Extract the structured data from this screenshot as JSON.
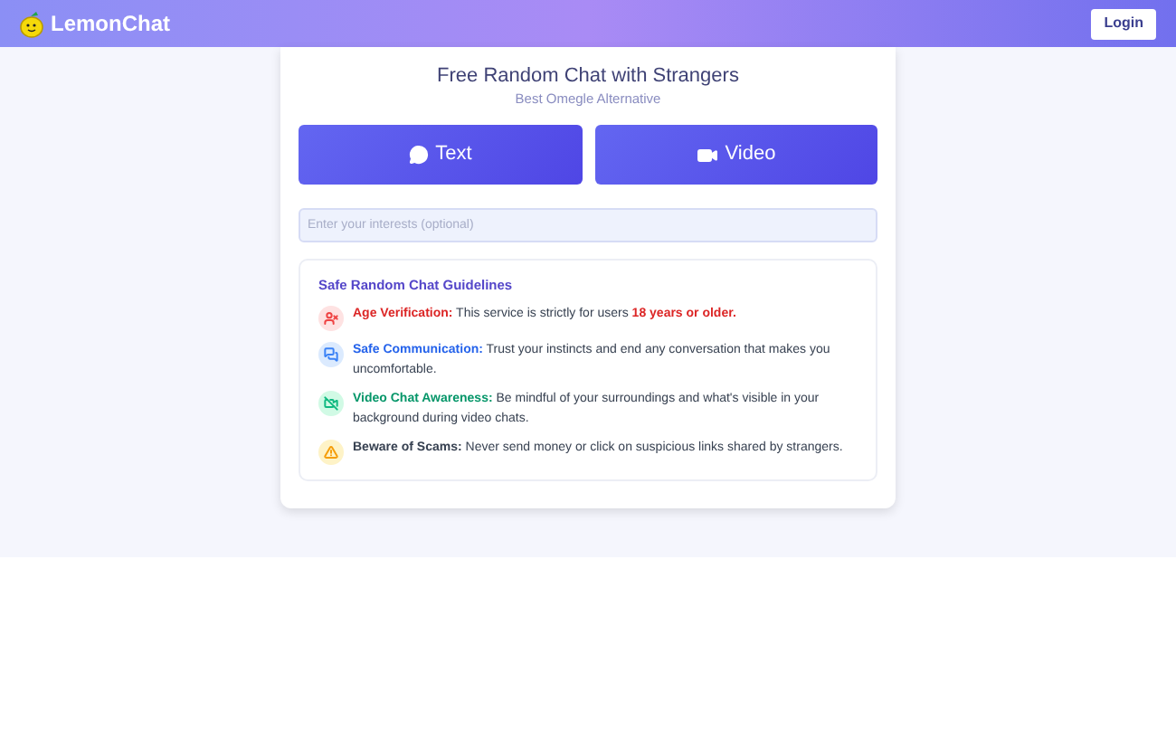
{
  "header": {
    "brand": "LemonChat",
    "login": "Login"
  },
  "hero": {
    "title": "Free Random Chat with Strangers",
    "subtitle": "Best Omegle Alternative"
  },
  "modes": [
    {
      "kind": "text",
      "label": "Text"
    },
    {
      "kind": "video",
      "label": "Video"
    }
  ],
  "interests": {
    "placeholder": "Enter your interests (optional)"
  },
  "guidelines": {
    "title": "Safe Random Chat Guidelines",
    "items": [
      {
        "kind": "age",
        "color": "#dc2626",
        "lead": "Age Verification:",
        "text": " This service is strictly for users ",
        "highlight": "18 years or older."
      },
      {
        "kind": "chat",
        "color": "#2563eb",
        "lead": "Safe Communication:",
        "text": " Trust your instincts and end any conversation that makes you uncomfortable."
      },
      {
        "kind": "video",
        "color": "#059669",
        "lead": "Video Chat Awareness:",
        "text": " Be mindful of your surroundings and what's visible in your background during video chats."
      },
      {
        "kind": "warning",
        "color": "#374151",
        "lead": "Beware of Scams:",
        "text": " Never send money or click on suspicious links shared by strangers."
      }
    ]
  }
}
